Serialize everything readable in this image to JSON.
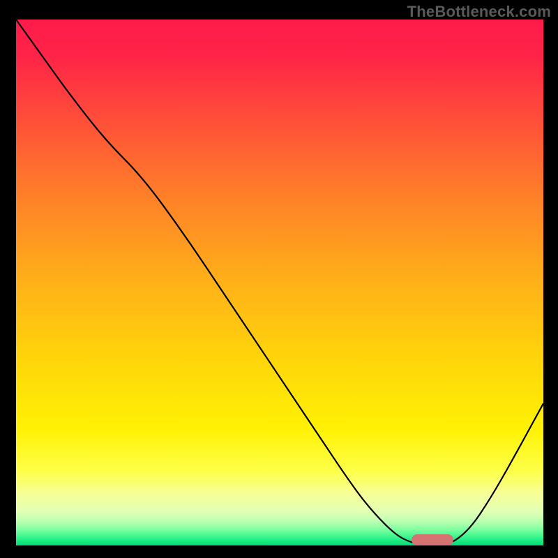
{
  "watermark": "TheBottleneck.com",
  "chart_data": {
    "type": "line",
    "title": "",
    "xlabel": "",
    "ylabel": "",
    "xlim": [
      0,
      100
    ],
    "ylim": [
      0,
      100
    ],
    "grid": false,
    "legend": false,
    "background": {
      "type": "vertical-gradient",
      "stops": [
        {
          "pos": 0.0,
          "color": "#ff1b4b"
        },
        {
          "pos": 0.07,
          "color": "#ff2447"
        },
        {
          "pos": 0.2,
          "color": "#ff5238"
        },
        {
          "pos": 0.35,
          "color": "#ff8427"
        },
        {
          "pos": 0.5,
          "color": "#ffb119"
        },
        {
          "pos": 0.65,
          "color": "#ffd60a"
        },
        {
          "pos": 0.78,
          "color": "#fff205"
        },
        {
          "pos": 0.86,
          "color": "#fdff4a"
        },
        {
          "pos": 0.9,
          "color": "#f7ff96"
        },
        {
          "pos": 0.935,
          "color": "#e3ffb4"
        },
        {
          "pos": 0.955,
          "color": "#b8ffb0"
        },
        {
          "pos": 0.97,
          "color": "#7dffa0"
        },
        {
          "pos": 0.985,
          "color": "#33f58c"
        },
        {
          "pos": 1.0,
          "color": "#00dd74"
        }
      ]
    },
    "series": [
      {
        "name": "bottleneck-curve",
        "color": "#000000",
        "x": [
          0,
          5,
          10,
          17,
          24,
          32,
          40,
          48,
          56,
          64,
          68,
          72,
          75,
          78,
          82,
          86,
          90,
          94,
          100
        ],
        "values": [
          100,
          93,
          86,
          77,
          70,
          59,
          47,
          35,
          23,
          11,
          6,
          2,
          0.5,
          0,
          0,
          3,
          9,
          16,
          27
        ]
      }
    ],
    "marker": {
      "name": "optimal-range",
      "color": "#d57373",
      "x_start": 75,
      "x_end": 83,
      "y": 1
    }
  }
}
